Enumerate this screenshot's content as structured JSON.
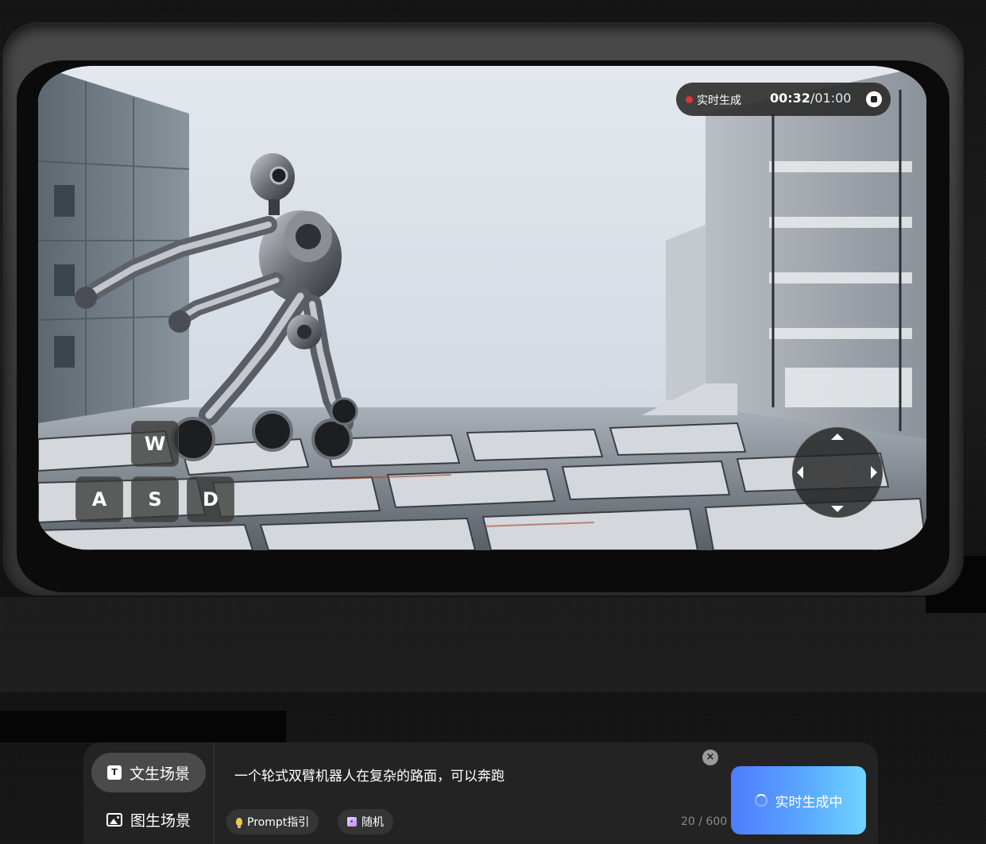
{
  "status": {
    "live_label": "实时生成",
    "elapsed": "00:32",
    "separator_total": "/01:00",
    "live_dot_color": "#e23232"
  },
  "controls": {
    "keys": {
      "w": "W",
      "a": "A",
      "s": "S",
      "d": "D"
    },
    "joystick": "joystick"
  },
  "modes": {
    "text_scene": {
      "label": "文生场景",
      "icon": "text-icon",
      "active": true
    },
    "image_scene": {
      "label": "图生场景",
      "icon": "image-icon",
      "active": false
    }
  },
  "prompt": {
    "text": "一个轮式双臂机器人在复杂的路面，可以奔跑",
    "clear_symbol": "×",
    "chips": {
      "guide": "Prompt指引",
      "random": "随机"
    },
    "counter": "20 / 600"
  },
  "generate_button": {
    "label": "实时生成中",
    "gradient_start": "#4f7bff",
    "gradient_end": "#6fd4ff"
  }
}
